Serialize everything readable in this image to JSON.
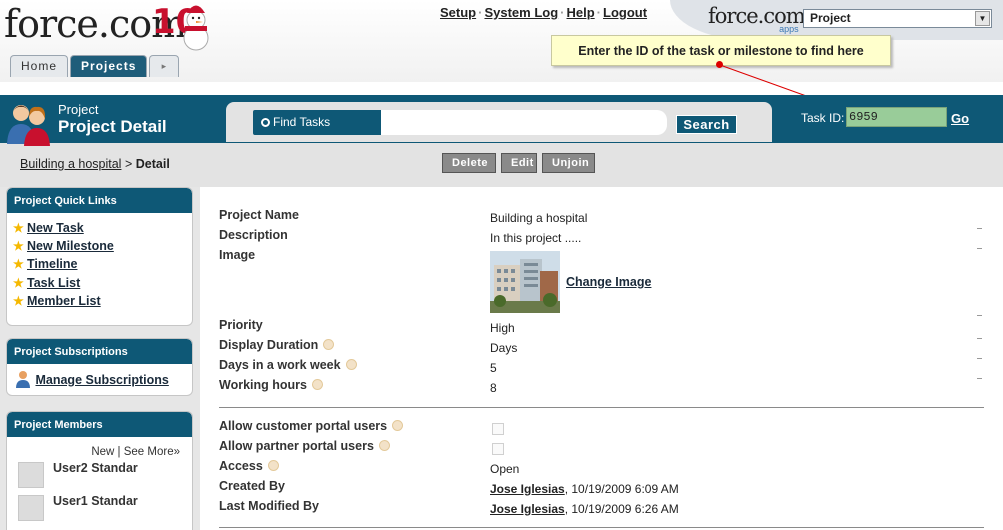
{
  "brand": {
    "logo_text": "force.com",
    "logo_number": "10",
    "small_logo_text": "force.com",
    "small_logo_sub": "apps"
  },
  "tabs": [
    {
      "label": "Home"
    },
    {
      "label": "Projects"
    },
    {
      "label": "▸"
    }
  ],
  "toplinks": {
    "setup": "Setup",
    "system_log": "System Log",
    "help": "Help",
    "logout": "Logout"
  },
  "app_selector": {
    "value": "Project",
    "arrow": "▼"
  },
  "tooltip": {
    "text": "Enter the ID of the task or milestone to find here"
  },
  "header": {
    "object_type": "Project",
    "page_title": "Project Detail"
  },
  "search": {
    "label": "Find Tasks",
    "button": "Search",
    "value": ""
  },
  "task_id": {
    "label": "Task ID:",
    "value": "6959",
    "go": "Go"
  },
  "breadcrumb": {
    "parent": "Building a hospital",
    "separator": ">",
    "current": "Detail"
  },
  "actions": {
    "delete": "Delete",
    "edit": "Edit",
    "unjoin": "Unjoin"
  },
  "sidebar": {
    "quick_links": {
      "title": "Project Quick Links",
      "items": [
        {
          "label": "New Task"
        },
        {
          "label": "New Milestone"
        },
        {
          "label": "Timeline"
        },
        {
          "label": "Task List"
        },
        {
          "label": "Member List"
        }
      ]
    },
    "subscriptions": {
      "title": "Project Subscriptions",
      "item": "Manage Subscriptions"
    },
    "members": {
      "title": "Project Members",
      "new_link": "New",
      "see_more": "See More»",
      "users": [
        {
          "name": "User2 Standar"
        },
        {
          "name": "User1 Standar"
        }
      ]
    }
  },
  "detail": {
    "project_name": {
      "label": "Project Name",
      "value": "Building a hospital"
    },
    "description": {
      "label": "Description",
      "value": "In this project ....."
    },
    "image": {
      "label": "Image",
      "change_link": "Change Image"
    },
    "priority": {
      "label": "Priority",
      "value": "High"
    },
    "display_duration": {
      "label": "Display Duration",
      "value": "Days"
    },
    "days_in_week": {
      "label": "Days in a work week",
      "value": "5"
    },
    "working_hours": {
      "label": "Working hours",
      "value": "8"
    },
    "allow_customer": {
      "label": "Allow customer portal users",
      "checked": false
    },
    "allow_partner": {
      "label": "Allow partner portal users",
      "checked": false
    },
    "access": {
      "label": "Access",
      "value": "Open"
    },
    "created_by": {
      "label": "Created By",
      "user": "Jose Iglesias",
      "date": ", 10/19/2009 6:09 AM"
    },
    "last_modified_by": {
      "label": "Last Modified By",
      "user": "Jose Iglesias",
      "date": ", 10/19/2009 6:26 AM"
    }
  },
  "colors": {
    "primary": "#0e5876",
    "task_id_bg": "#99cc99",
    "tooltip_bg": "#ffffcc",
    "star": "#f5b800"
  }
}
